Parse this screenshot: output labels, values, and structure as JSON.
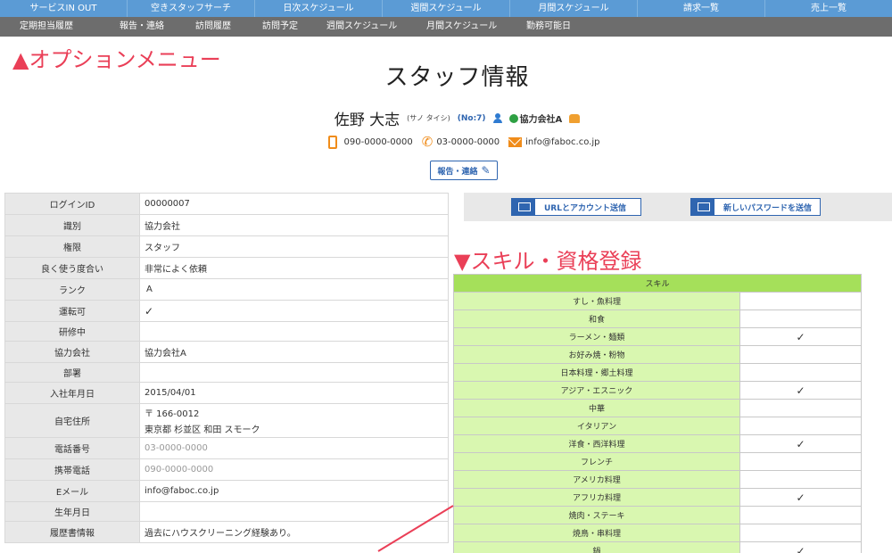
{
  "nav_primary": [
    "サービスIN OUT",
    "空きスタッフサーチ",
    "日次スケジュール",
    "週間スケジュール",
    "月間スケジュール",
    "請求一覧",
    "売上一覧"
  ],
  "nav_secondary": [
    "定期担当履歴",
    "報告・連絡",
    "訪問履歴",
    "訪問予定",
    "週間スケジュール",
    "月間スケジュール",
    "勤務可能日"
  ],
  "annotations": {
    "option_menu": "▲オプションメニュー",
    "skill_register": "▼スキル・資格登録"
  },
  "page_title": "スタッフ情報",
  "staff": {
    "name": "佐野 大志",
    "kana": "(サノ タイシ)",
    "number": "(No:7)",
    "company": "協力会社A",
    "mobile": "090-0000-0000",
    "tel": "03-0000-0000",
    "email": "info@faboc.co.jp"
  },
  "report_button": "報告・連絡",
  "actions": {
    "send_url": "URLとアカウント送信",
    "send_password": "新しいパスワードを送信"
  },
  "info_rows": [
    {
      "label": "ログインID",
      "value": "00000007"
    },
    {
      "label": "識別",
      "value": "協力会社"
    },
    {
      "label": "権限",
      "value": "スタッフ"
    },
    {
      "label": "良く使う度合い",
      "value": "非常によく依頼"
    },
    {
      "label": "ランク",
      "value": "A"
    },
    {
      "label": "運転可",
      "value": "✓"
    },
    {
      "label": "研修中",
      "value": ""
    },
    {
      "label": "協力会社",
      "value": "協力会社A"
    },
    {
      "label": "部署",
      "value": ""
    },
    {
      "label": "入社年月日",
      "value": "2015/04/01"
    },
    {
      "label": "自宅住所",
      "value": "〒 166-0012",
      "value2": "東京都 杉並区 和田 スモーク"
    },
    {
      "label": "電話番号",
      "value": "03-0000-0000"
    },
    {
      "label": "携帯電話",
      "value": "090-0000-0000"
    },
    {
      "label": "Eメール",
      "value": "info@faboc.co.jp"
    },
    {
      "label": "生年月日",
      "value": ""
    },
    {
      "label": "履歴書情報",
      "value": "過去にハウスクリーニング経験あり。"
    }
  ],
  "skill_header": "スキル",
  "skills": [
    {
      "name": "すし・魚料理",
      "check": ""
    },
    {
      "name": "和食",
      "check": ""
    },
    {
      "name": "ラーメン・麺類",
      "check": "✓"
    },
    {
      "name": "お好み焼・粉物",
      "check": ""
    },
    {
      "name": "日本料理・郷土料理",
      "check": ""
    },
    {
      "name": "アジア・エスニック",
      "check": "✓"
    },
    {
      "name": "中華",
      "check": ""
    },
    {
      "name": "イタリアン",
      "check": ""
    },
    {
      "name": "洋食・西洋料理",
      "check": "✓"
    },
    {
      "name": "フレンチ",
      "check": ""
    },
    {
      "name": "アメリカ料理",
      "check": ""
    },
    {
      "name": "アフリカ料理",
      "check": "✓"
    },
    {
      "name": "焼肉・ステーキ",
      "check": ""
    },
    {
      "name": "焼鳥・串料理",
      "check": ""
    },
    {
      "name": "鍋",
      "check": "✓"
    }
  ],
  "colors": {
    "nav_primary_bg": "#5b9bd5",
    "nav_secondary_bg": "#6d6d6d",
    "annotation": "#ea3f57",
    "skill_header_bg": "#a5e05a",
    "skill_name_bg": "#d9f7b0",
    "link_blue": "#2f65b0"
  }
}
